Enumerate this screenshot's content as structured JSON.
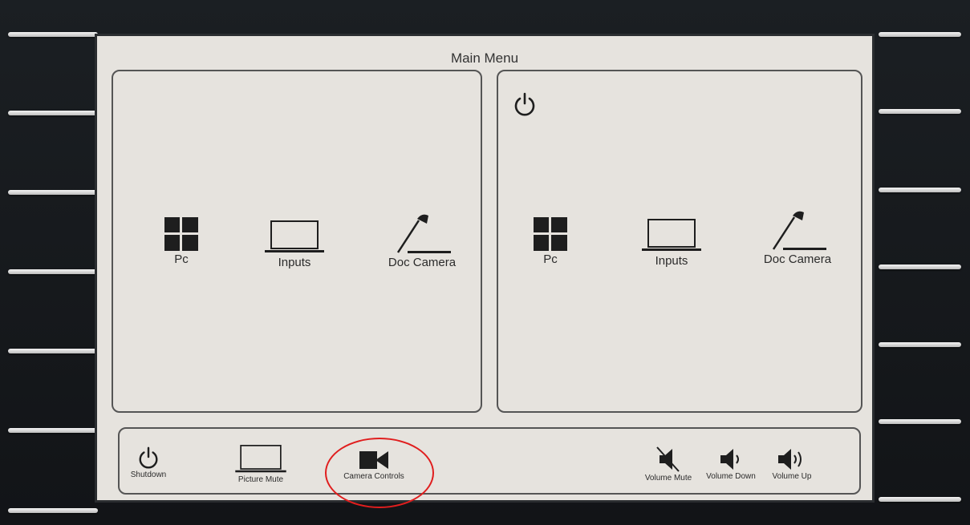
{
  "screen": {
    "title": "Main Menu"
  },
  "left_panel": {
    "sources": [
      {
        "label": "Pc",
        "icon": "windows-icon"
      },
      {
        "label": "Inputs",
        "icon": "laptop-icon"
      },
      {
        "label": "Doc Camera",
        "icon": "doc-camera-icon"
      }
    ]
  },
  "right_panel": {
    "power_icon": "power-icon",
    "sources": [
      {
        "label": "Pc",
        "icon": "windows-icon"
      },
      {
        "label": "Inputs",
        "icon": "laptop-icon"
      },
      {
        "label": "Doc Camera",
        "icon": "doc-camera-icon"
      }
    ]
  },
  "bottom_bar": {
    "shutdown_label": "Shutdown",
    "picture_mute_label": "Picture Mute",
    "camera_controls_label": "Camera Controls",
    "volume_mute_label": "Volume Mute",
    "volume_down_label": "Volume Down",
    "volume_up_label": "Volume Up"
  },
  "annotation": {
    "highlight_color": "#e01e1e"
  }
}
